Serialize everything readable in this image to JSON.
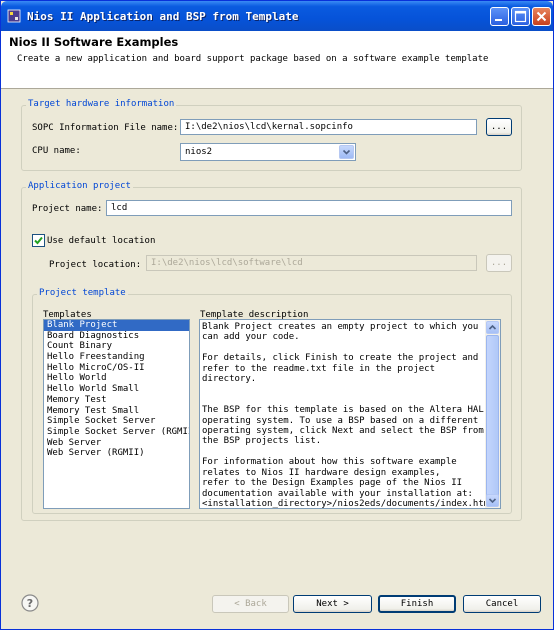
{
  "window": {
    "title": "Nios II Application and BSP from Template",
    "minimize_icon": "minimize-icon",
    "maximize_icon": "maximize-icon",
    "close_icon": "close-icon"
  },
  "banner": {
    "title": "Nios II Software Examples",
    "description": "Create a new application and board support package based on a software example template"
  },
  "target_hardware": {
    "group_title": "Target hardware information",
    "sopc_label": "SOPC Information File name:",
    "sopc_value": "I:\\de2\\nios\\lcd\\kernal.sopcinfo",
    "browse_label": "...",
    "cpu_label": "CPU name:",
    "cpu_value": "nios2"
  },
  "application_project": {
    "group_title": "Application project",
    "name_label": "Project name:",
    "name_value": "lcd",
    "default_location_label": "Use default location",
    "default_location_checked": true,
    "location_label": "Project location:",
    "location_value": "I:\\de2\\nios\\lcd\\software\\lcd",
    "browse_label": "..."
  },
  "project_template": {
    "group_title": "Project template",
    "templates_label": "Templates",
    "description_label": "Template description",
    "templates": [
      "Blank Project",
      "Board Diagnostics",
      "Count Binary",
      "Hello Freestanding",
      "Hello MicroC/OS-II",
      "Hello World",
      "Hello World Small",
      "Memory Test",
      "Memory Test Small",
      "Simple Socket Server",
      "Simple Socket Server (RGMII)",
      "Web Server",
      "Web Server (RGMII)"
    ],
    "selected_template": "Blank Project",
    "description": "Blank Project creates an empty project to which you\ncan add your code.\n\nFor details, click Finish to create the project and\nrefer to the readme.txt file in the project directory.\n\n\nThe BSP for this template is based on the Altera HAL\noperating system. To use a BSP based on a different\noperating system, click Next and select the BSP from\nthe BSP projects list.\n\nFor information about how this software example\nrelates to Nios II hardware design examples,\nrefer to the Design Examples page of the Nios II\ndocumentation available with your installation at:\n<installation_directory>/nios2eds/documents/index.htm."
  },
  "footer": {
    "help_icon": "help-icon",
    "back_label": "< Back",
    "next_label": "Next >",
    "finish_label": "Finish",
    "cancel_label": "Cancel"
  },
  "colors": {
    "title_bar": "#0653d9",
    "dialog_bg": "#ece9d8",
    "group_title": "#0046d5",
    "selection": "#316ac5"
  }
}
